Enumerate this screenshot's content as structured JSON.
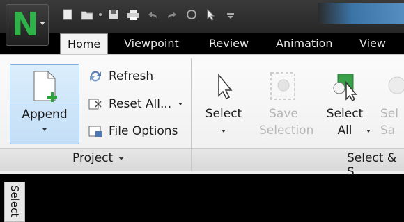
{
  "app": {
    "logo_letter": "N"
  },
  "tabs": [
    {
      "label": "Home",
      "active": true
    },
    {
      "label": "Viewpoint"
    },
    {
      "label": "Review"
    },
    {
      "label": "Animation"
    },
    {
      "label": "View"
    }
  ],
  "project_group": {
    "append_label": "Append",
    "refresh_label": "Refresh",
    "reset_all_label": "Reset All...",
    "file_options_label": "File Options",
    "group_label": "Project"
  },
  "select_group": {
    "select_label": "Select",
    "save_selection_line1": "Save",
    "save_selection_line2": "Selection",
    "select_all_line1": "Select",
    "select_all_line2": "All",
    "partial_label_line1": "Sel",
    "partial_label_line2": "Sa",
    "group_label": "Select & S"
  },
  "side_panel": {
    "tab_label": "Select"
  },
  "colors": {
    "accent_green": "#2fb24a",
    "append_bg": "#c3def6",
    "canvas": "#000000"
  }
}
